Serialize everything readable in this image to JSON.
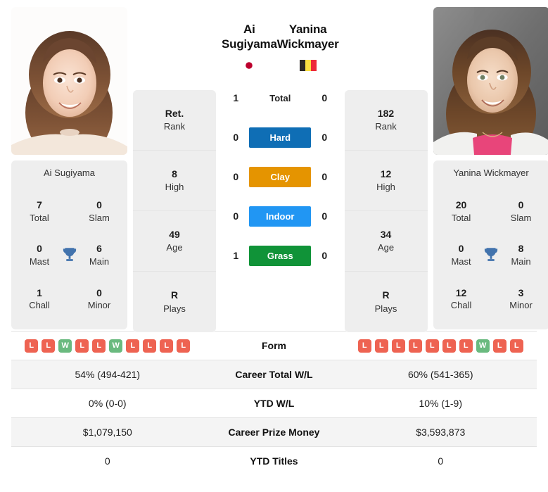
{
  "players": {
    "left": {
      "name": "Ai Sugiyama",
      "flag": "japan-flag",
      "photo_alt": "Ai Sugiyama portrait",
      "card_name": "Ai Sugiyama",
      "info": [
        {
          "value": "Ret.",
          "label": "Rank"
        },
        {
          "value": "8",
          "label": "High"
        },
        {
          "value": "49",
          "label": "Age"
        },
        {
          "value": "R",
          "label": "Plays"
        }
      ],
      "titles": [
        {
          "value": "7",
          "label": "Total"
        },
        {
          "value": "0",
          "label": "Slam"
        },
        {
          "value": "0",
          "label": "Mast"
        },
        {
          "value": "6",
          "label": "Main"
        },
        {
          "value": "1",
          "label": "Chall"
        },
        {
          "value": "0",
          "label": "Minor"
        }
      ],
      "form": [
        "L",
        "L",
        "W",
        "L",
        "L",
        "W",
        "L",
        "L",
        "L",
        "L"
      ],
      "career_wl": "54% (494-421)",
      "ytd_wl": "0% (0-0)",
      "prize_money": "$1,079,150",
      "ytd_titles": "0"
    },
    "right": {
      "name": "Yanina Wickmayer",
      "flag": "belgium-flag",
      "photo_alt": "Yanina Wickmayer portrait",
      "card_name": "Yanina Wickmayer",
      "info": [
        {
          "value": "182",
          "label": "Rank"
        },
        {
          "value": "12",
          "label": "High"
        },
        {
          "value": "34",
          "label": "Age"
        },
        {
          "value": "R",
          "label": "Plays"
        }
      ],
      "titles": [
        {
          "value": "20",
          "label": "Total"
        },
        {
          "value": "0",
          "label": "Slam"
        },
        {
          "value": "0",
          "label": "Mast"
        },
        {
          "value": "8",
          "label": "Main"
        },
        {
          "value": "12",
          "label": "Chall"
        },
        {
          "value": "3",
          "label": "Minor"
        }
      ],
      "form": [
        "L",
        "L",
        "L",
        "L",
        "L",
        "L",
        "L",
        "W",
        "L",
        "L"
      ],
      "career_wl": "60% (541-365)",
      "ytd_wl": "10% (1-9)",
      "prize_money": "$3,593,873",
      "ytd_titles": "0"
    }
  },
  "head_to_head": [
    {
      "label": "Total",
      "left": "1",
      "right": "0",
      "style": "plain",
      "color": ""
    },
    {
      "label": "Hard",
      "left": "0",
      "right": "0",
      "style": "colored",
      "color": "#0f6eb5"
    },
    {
      "label": "Clay",
      "left": "0",
      "right": "0",
      "style": "colored",
      "color": "#e59400"
    },
    {
      "label": "Indoor",
      "left": "0",
      "right": "0",
      "style": "colored",
      "color": "#2196f3"
    },
    {
      "label": "Grass",
      "left": "1",
      "right": "0",
      "style": "colored",
      "color": "#109338"
    }
  ],
  "stats_rows": [
    {
      "label": "Form",
      "type": "form",
      "shaded": false
    },
    {
      "label": "Career Total W/L",
      "type": "text",
      "shaded": true,
      "left": "54% (494-421)",
      "right": "60% (541-365)"
    },
    {
      "label": "YTD W/L",
      "type": "text",
      "shaded": false,
      "left": "0% (0-0)",
      "right": "10% (1-9)"
    },
    {
      "label": "Career Prize Money",
      "type": "text",
      "shaded": true,
      "left": "$1,079,150",
      "right": "$3,593,873"
    },
    {
      "label": "YTD Titles",
      "type": "text",
      "shaded": false,
      "left": "0",
      "right": "0"
    }
  ],
  "colors": {
    "win_badge": "#6aba7f",
    "loss_badge": "#ee6352",
    "trophy": "#4273ad",
    "card_bg": "#eeeeee",
    "row_shade": "#f4f4f4"
  },
  "icons": {
    "trophy": "trophy-icon"
  }
}
